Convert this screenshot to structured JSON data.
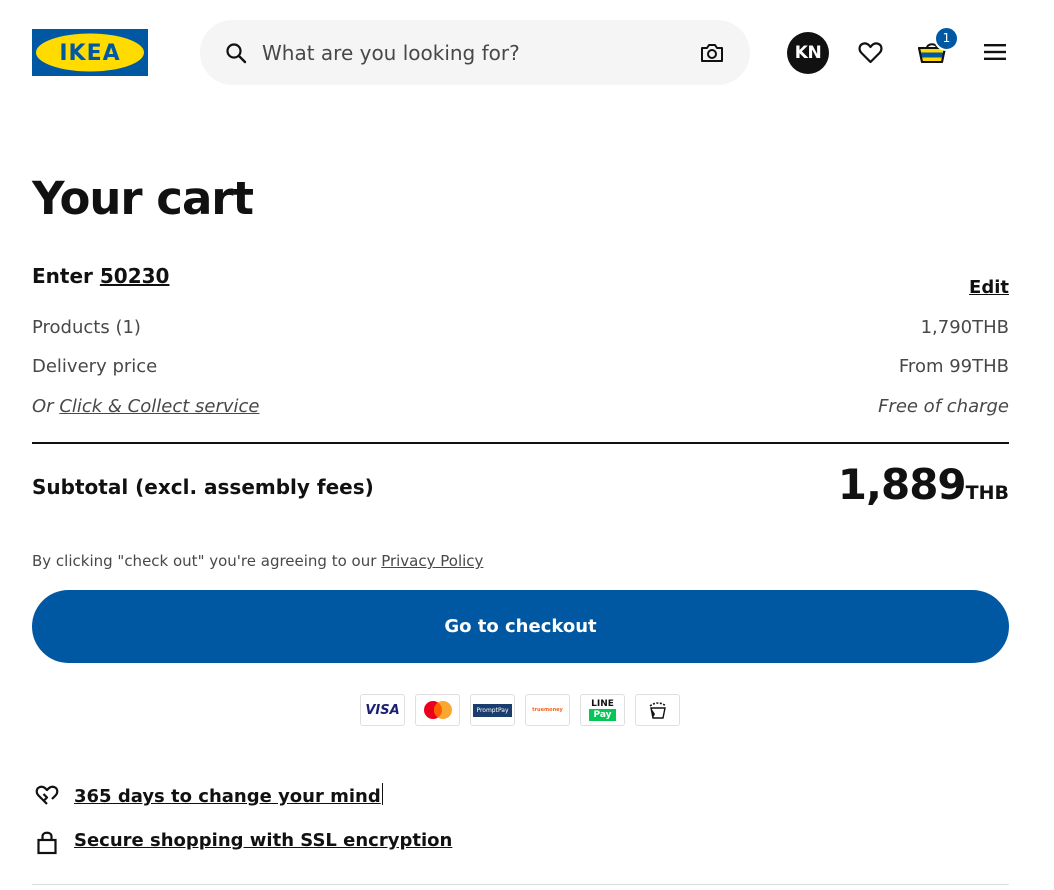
{
  "header": {
    "logo_text": "IKEA",
    "search_placeholder": "What are you looking for?",
    "avatar_initials": "KN",
    "cart_count": "1",
    "icons": [
      "search-icon",
      "camera-icon",
      "heart-icon",
      "basket-icon",
      "menu-icon"
    ]
  },
  "cart": {
    "title": "Your cart",
    "enter_label": "Enter",
    "postcode": "50230",
    "edit_label": "Edit",
    "products_label": "Products (1)",
    "products_value": "1,790THB",
    "delivery_label": "Delivery price",
    "delivery_value": "From 99THB",
    "collect_prefix": "Or",
    "collect_link": "Click & Collect service",
    "collect_value": "Free of charge",
    "subtotal_label": "Subtotal (excl. assembly fees)",
    "subtotal_amount": "1,889",
    "subtotal_currency": "THB",
    "consent_text": "By clicking \"check out\" you're agreeing to our",
    "privacy_link": "Privacy Policy",
    "checkout_label": "Go to checkout"
  },
  "payments": {
    "visa": "VISA",
    "promptpay": "PromptPay",
    "truemoney": "truemoney",
    "line_top": "LINE",
    "line_bottom": "Pay"
  },
  "usps": [
    {
      "text": "365 days to change your mind",
      "icon": "heart-return-icon"
    },
    {
      "text": "Secure shopping with SSL encryption",
      "icon": "lock-icon"
    }
  ],
  "colors": {
    "brand_blue": "#0058a3",
    "brand_yellow": "#ffdb00",
    "text": "#111111",
    "muted": "#484848"
  }
}
